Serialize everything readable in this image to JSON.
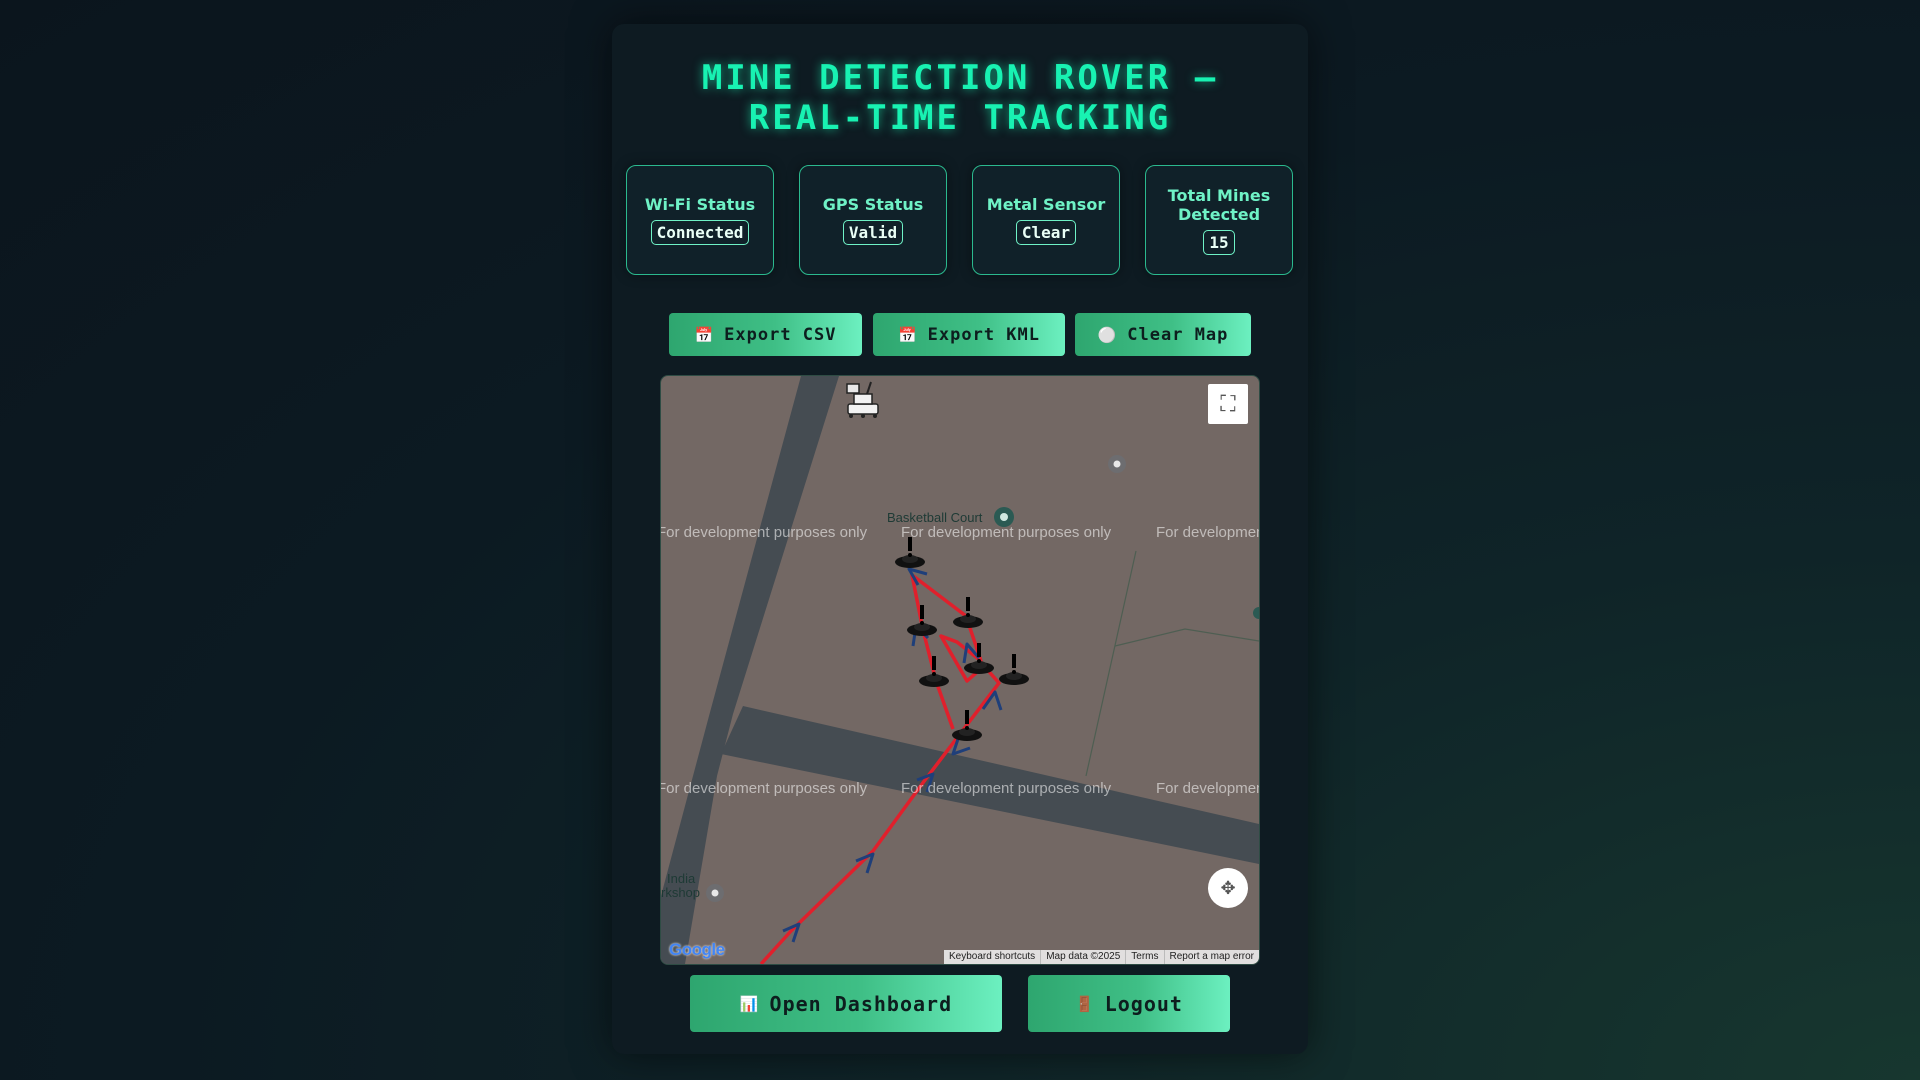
{
  "header": {
    "title": "Mine Detection Rover – Real-Time Tracking"
  },
  "status_cards": [
    {
      "label": "Wi-Fi Status",
      "value": "Connected"
    },
    {
      "label": "GPS Status",
      "value": "Valid"
    },
    {
      "label": "Metal Sensor",
      "value": "Clear"
    },
    {
      "label": "Total Mines Detected",
      "value": "15"
    }
  ],
  "toolbar": {
    "export_csv": {
      "label": "Export CSV",
      "icon": "calendar-icon"
    },
    "export_kml": {
      "label": "Export KML",
      "icon": "calendar-icon"
    },
    "clear_map": {
      "label": "Clear Map",
      "icon": "circle-icon"
    }
  },
  "map": {
    "watermark": "For development purposes only",
    "poi_basketball": "Basketball Court",
    "poi_india": "India",
    "poi_workshop": "rkshop",
    "logo": "Google",
    "attribution": {
      "keyboard_shortcuts": "Keyboard shortcuts",
      "map_data": "Map data ©2025",
      "terms": "Terms",
      "report": "Report a map error"
    },
    "colors": {
      "track": "#e0202c",
      "arrow": "#1f3f7a",
      "road": "#454c52",
      "ground": "#736864"
    }
  },
  "footer": {
    "dashboard": {
      "label": "Open Dashboard",
      "icon": "chart-icon"
    },
    "logout": {
      "label": "Logout",
      "icon": "door-icon"
    }
  }
}
